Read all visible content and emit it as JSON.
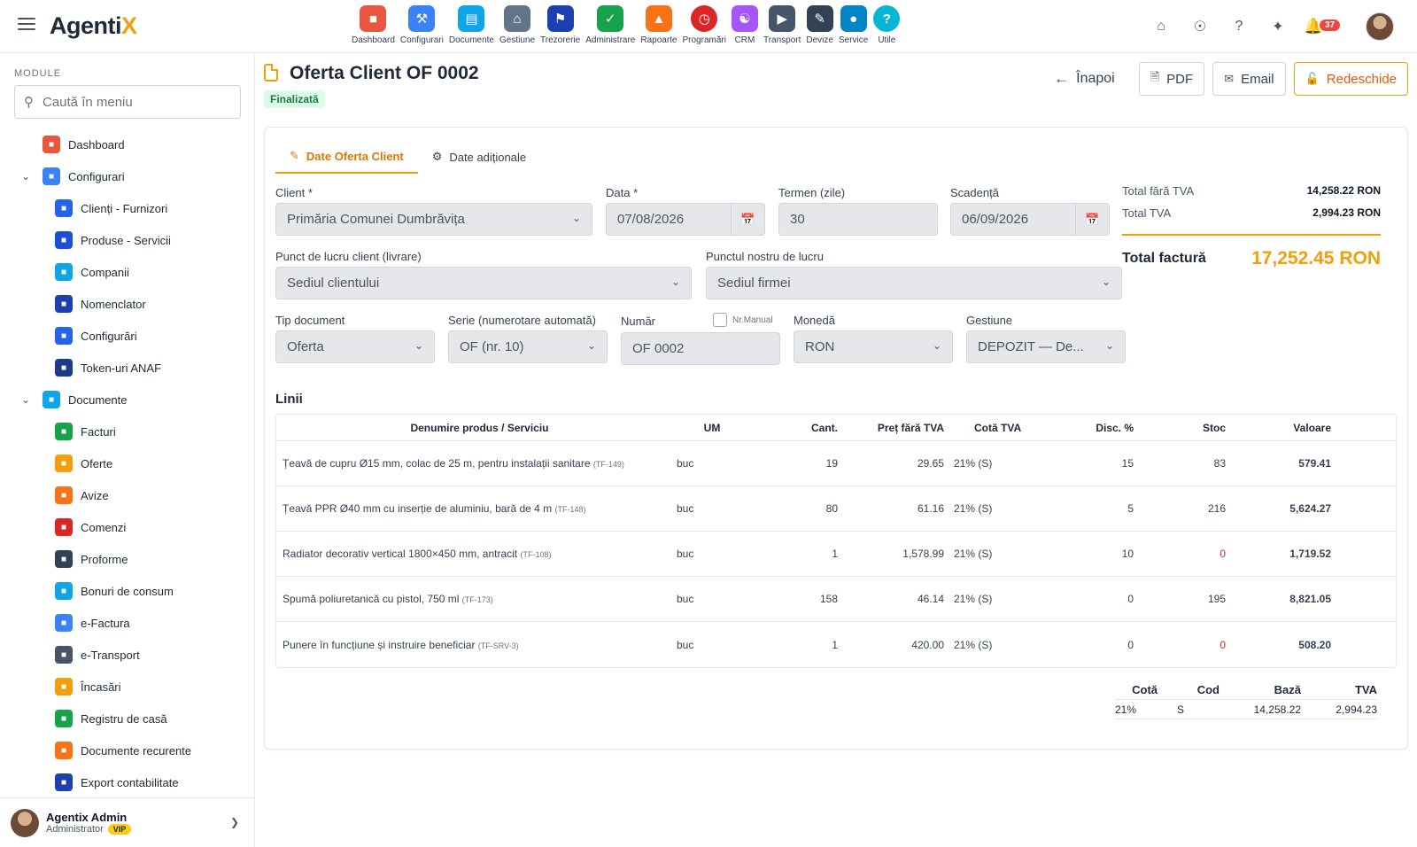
{
  "app": {
    "logo_main": "Agenti",
    "logo_accent": "X"
  },
  "modules": [
    {
      "label": "Dashboard",
      "icon": "dashboard-icon",
      "color": "#e8563f"
    },
    {
      "label": "Configurari",
      "icon": "wrench-icon",
      "color": "#3b82f6"
    },
    {
      "label": "Documente",
      "icon": "folder-icon",
      "color": "#0ea5e9"
    },
    {
      "label": "Gestiune",
      "icon": "warehouse-icon",
      "color": "#64748b"
    },
    {
      "label": "Trezorerie",
      "icon": "bank-icon",
      "color": "#1e40af"
    },
    {
      "label": "Administrare",
      "icon": "shield-icon",
      "color": "#16a34a"
    },
    {
      "label": "Rapoarte",
      "icon": "report-icon",
      "color": "#f97316"
    },
    {
      "label": "Programări",
      "icon": "clock-icon",
      "color": "#dc2626"
    },
    {
      "label": "CRM",
      "icon": "crm-icon",
      "color": "#a855f7"
    },
    {
      "label": "Transport",
      "icon": "truck-icon",
      "color": "#475569"
    },
    {
      "label": "Devize",
      "icon": "estimate-icon",
      "color": "#334155"
    },
    {
      "label": "Service",
      "icon": "car-icon",
      "color": "#0284c7"
    },
    {
      "label": "Utile",
      "icon": "help-icon",
      "color": "#06b6d4"
    }
  ],
  "notifications": {
    "count": "37"
  },
  "sidebar": {
    "heading": "MODULE",
    "search_placeholder": "Caută în meniu",
    "items": [
      {
        "label": "Dashboard",
        "level": 1,
        "icon": "dashboard-icon",
        "color": "#e8563f"
      },
      {
        "label": "Configurari",
        "level": 1,
        "icon": "wrench-icon",
        "color": "#3b82f6",
        "expanded": true
      },
      {
        "label": "Clienți - Furnizori",
        "level": 2,
        "icon": "users-icon",
        "color": "#2563eb"
      },
      {
        "label": "Produse - Servicii",
        "level": 2,
        "icon": "catalog-icon",
        "color": "#1d4ed8"
      },
      {
        "label": "Companii",
        "level": 2,
        "icon": "company-icon",
        "color": "#0ea5e9"
      },
      {
        "label": "Nomenclator",
        "level": 2,
        "icon": "list-icon",
        "color": "#1e40af"
      },
      {
        "label": "Configurări",
        "level": 2,
        "icon": "settings-list-icon",
        "color": "#2563eb"
      },
      {
        "label": "Token-uri ANAF",
        "level": 2,
        "icon": "token-shield-icon",
        "color": "#1e3a8a"
      },
      {
        "label": "Documente",
        "level": 1,
        "icon": "folder-icon",
        "color": "#0ea5e9",
        "expanded": true
      },
      {
        "label": "Facturi",
        "level": 2,
        "icon": "invoice-icon",
        "color": "#16a34a"
      },
      {
        "label": "Oferte",
        "level": 2,
        "icon": "offer-icon",
        "color": "#f59e0b"
      },
      {
        "label": "Avize",
        "level": 2,
        "icon": "delivery-icon",
        "color": "#f97316"
      },
      {
        "label": "Comenzi",
        "level": 2,
        "icon": "cart-icon",
        "color": "#dc2626"
      },
      {
        "label": "Proforme",
        "level": 2,
        "icon": "calculator-icon",
        "color": "#334155"
      },
      {
        "label": "Bonuri de consum",
        "level": 2,
        "icon": "receipt-icon",
        "color": "#0ea5e9"
      },
      {
        "label": "e-Factura",
        "level": 2,
        "icon": "cloud-icon",
        "color": "#3b82f6"
      },
      {
        "label": "e-Transport",
        "level": 2,
        "icon": "truck-icon",
        "color": "#475569"
      },
      {
        "label": "Încasări",
        "level": 2,
        "icon": "chart-coins-icon",
        "color": "#f59e0b"
      },
      {
        "label": "Registru de casă",
        "level": 2,
        "icon": "cash-register-icon",
        "color": "#16a34a"
      },
      {
        "label": "Documente recurente",
        "level": 2,
        "icon": "recurring-icon",
        "color": "#f97316"
      },
      {
        "label": "Export contabilitate",
        "level": 2,
        "icon": "database-export-icon",
        "color": "#1e40af"
      }
    ],
    "user": {
      "name": "Agentix Admin",
      "role": "Administrator",
      "badge": "VIP"
    }
  },
  "header": {
    "title": "Oferta Client OF 0002",
    "status": "Finalizată",
    "back_label": "Înapoi",
    "pdf_label": "PDF",
    "email_label": "Email",
    "reopen_label": "Redeschide"
  },
  "tabs": [
    {
      "label": "Date Oferta Client",
      "icon": "edit-icon",
      "active": true
    },
    {
      "label": "Date adiționale",
      "icon": "gear-icon",
      "active": false
    }
  ],
  "form": {
    "client": {
      "label": "Client *",
      "value": "Primăria Comunei Dumbrăvița"
    },
    "data": {
      "label": "Data *",
      "value": "07/08/2026"
    },
    "termen": {
      "label": "Termen (zile)",
      "value": "30"
    },
    "scadenta": {
      "label": "Scadență",
      "value": "06/09/2026"
    },
    "punct_client": {
      "label": "Punct de lucru client (livrare)",
      "value": "Sediul clientului"
    },
    "punct_nostru": {
      "label": "Punctul nostru de lucru",
      "value": "Sediul firmei"
    },
    "tip_document": {
      "label": "Tip document",
      "value": "Oferta"
    },
    "serie": {
      "label": "Serie (numerotare automată)",
      "value": "OF (nr. 10)"
    },
    "numar": {
      "label": "Număr",
      "value": "OF 0002",
      "manual_label": "Nr.Manual"
    },
    "moneda": {
      "label": "Monedă",
      "value": "RON"
    },
    "gestiune": {
      "label": "Gestiune",
      "value": "DEPOZIT — De..."
    }
  },
  "totals": {
    "fara_tva_label": "Total fără TVA",
    "fara_tva_value": "14,258.22 RON",
    "tva_label": "Total TVA",
    "tva_value": "2,994.23 RON",
    "factura_label": "Total factură",
    "factura_value": "17,252.45 RON"
  },
  "lines": {
    "title": "Linii",
    "headers": {
      "name": "Denumire produs / Serviciu",
      "um": "UM",
      "cant": "Cant.",
      "pret": "Preț fără TVA",
      "cota": "Cotă TVA",
      "disc": "Disc. %",
      "stoc": "Stoc",
      "val": "Valoare"
    },
    "rows": [
      {
        "name": "Țeavă de cupru Ø15 mm, colac de 25 m, pentru instalații sanitare",
        "code": "(TF-149)",
        "um": "buc",
        "cant": "19",
        "pret": "29.65",
        "cota": "21% (S)",
        "disc": "15",
        "stoc": "83",
        "val": "579.41"
      },
      {
        "name": "Țeavă PPR Ø40 mm cu inserție de aluminiu, bară de 4 m",
        "code": "(TF-148)",
        "um": "buc",
        "cant": "80",
        "pret": "61.16",
        "cota": "21% (S)",
        "disc": "5",
        "stoc": "216",
        "val": "5,624.27"
      },
      {
        "name": "Radiator decorativ vertical 1800×450 mm, antracit",
        "code": "(TF-108)",
        "um": "buc",
        "cant": "1",
        "pret": "1,578.99",
        "cota": "21% (S)",
        "disc": "10",
        "stoc": "0",
        "val": "1,719.52"
      },
      {
        "name": "Spumă poliuretanică cu pistol, 750 ml",
        "code": "(TF-173)",
        "um": "buc",
        "cant": "158",
        "pret": "46.14",
        "cota": "21% (S)",
        "disc": "0",
        "stoc": "195",
        "val": "8,821.05"
      },
      {
        "name": "Punere în funcțiune și instruire beneficiar",
        "code": "(TF-SRV-3)",
        "um": "buc",
        "cant": "1",
        "pret": "420.00",
        "cota": "21% (S)",
        "disc": "0",
        "stoc": "0",
        "val": "508.20"
      }
    ]
  },
  "vat_summary": {
    "headers": {
      "cota": "Cotă",
      "cod": "Cod",
      "baza": "Bază",
      "tva": "TVA"
    },
    "rows": [
      {
        "cota": "21%",
        "cod": "S",
        "baza": "14,258.22",
        "tva": "2,994.23"
      }
    ]
  },
  "colors": {
    "accent": "#f59e0b",
    "status_green": "#15803d",
    "danger": "#dc2626"
  }
}
